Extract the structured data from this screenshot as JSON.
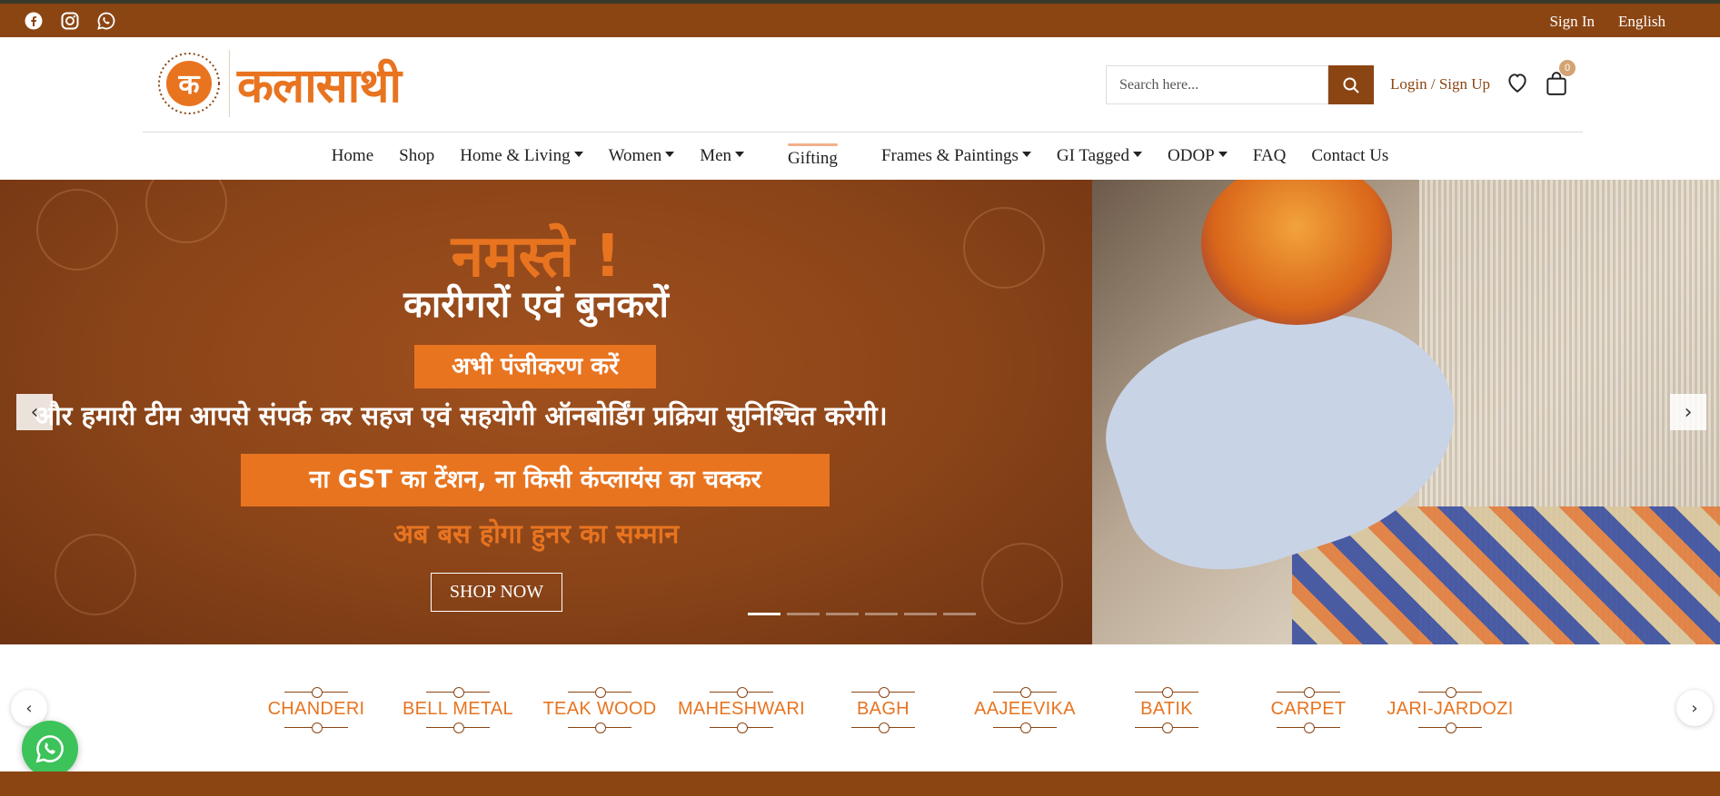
{
  "topbar": {
    "social": [
      "facebook-icon",
      "instagram-icon",
      "whatsapp-icon"
    ],
    "sign_in": "Sign In",
    "language": "English"
  },
  "header": {
    "logo_letter": "क",
    "logo_word": "कलासाथी",
    "search_placeholder": "Search here...",
    "login_label": "Login / Sign Up",
    "cart_count": "0"
  },
  "nav": {
    "items": [
      {
        "label": "Home",
        "dropdown": false
      },
      {
        "label": "Shop",
        "dropdown": false
      },
      {
        "label": "Home & Living",
        "dropdown": true
      },
      {
        "label": "Women",
        "dropdown": true
      },
      {
        "label": "Men",
        "dropdown": true
      },
      {
        "label": "Gifting",
        "dropdown": false
      },
      {
        "label": "Frames & Paintings",
        "dropdown": true
      },
      {
        "label": "GI Tagged",
        "dropdown": true
      },
      {
        "label": "ODOP",
        "dropdown": true
      },
      {
        "label": "FAQ",
        "dropdown": false
      },
      {
        "label": "Contact Us",
        "dropdown": false
      }
    ]
  },
  "hero": {
    "greeting": "नमस्ते !",
    "subtitle": "कारीगरों एवं बुनकरों",
    "register_cta": "अभी पंजीकरण करें",
    "message": "और हमारी टीम आपसे संपर्क कर सहज एवं सहयोगी ऑनबोर्डिंग प्रक्रिया सुनिश्चित करेगी।",
    "gst_banner": "ना GST का टेंशन, ना किसी कंप्लायंस का चक्कर",
    "tagline": "अब बस होगा हुनर का सम्मान",
    "shop_now": "SHOP NOW",
    "prev": "‹",
    "next": "›",
    "slide_count": 6,
    "active_slide": 1
  },
  "categories": {
    "items": [
      "CHANDERI",
      "BELL METAL",
      "TEAK WOOD",
      "MAHESHWARI",
      "BAGH",
      "AAJEEVIKA",
      "BATIK",
      "CARPET",
      "JARI-JARDOZI"
    ],
    "prev": "‹",
    "next": "›"
  },
  "colors": {
    "brand_brown": "#8b4513",
    "brand_orange": "#e87420",
    "whatsapp_green": "#3cc35a"
  }
}
